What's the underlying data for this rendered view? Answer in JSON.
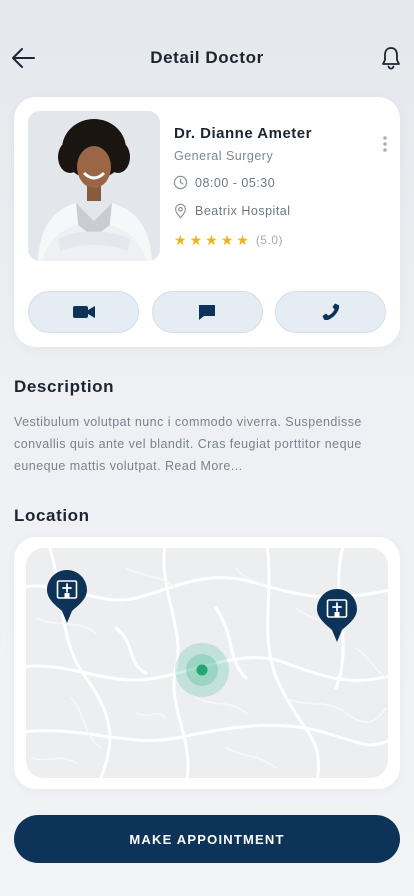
{
  "header": {
    "title": "Detail Doctor"
  },
  "doctor": {
    "name": "Dr. Dianne Ameter",
    "specialty": "General Surgery",
    "hours": "08:00 - 05:30",
    "hospital": "Beatrix Hospital",
    "rating_stars": 5,
    "rating_label": "(5.0)"
  },
  "description": {
    "title": "Description",
    "text": "Vestibulum volutpat nunc i commodo viverra. Suspendisse convallis quis ante vel blandit. Cras feugiat porttitor neque euneque mattis volutpat.",
    "read_more": "Read More..."
  },
  "location": {
    "title": "Location"
  },
  "cta": {
    "label": "MAKE APPOINTMENT"
  },
  "colors": {
    "primary": "#0e3358",
    "accent_green": "#2fb88a",
    "star": "#f2b316"
  }
}
